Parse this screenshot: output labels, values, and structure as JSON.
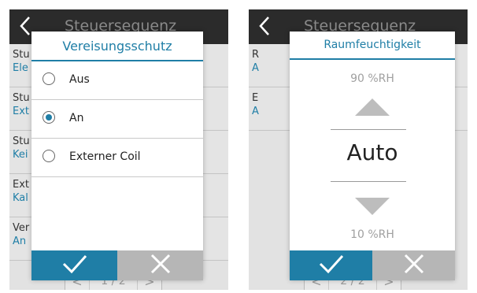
{
  "left_screen": {
    "header_title": "Steuersequenz",
    "background_rows": [
      {
        "label": "Stu",
        "value": "Ele"
      },
      {
        "label": "Stu",
        "value": "Ext"
      },
      {
        "label": "Stu",
        "value": "Kei"
      },
      {
        "label": "Ext",
        "value": "Kal"
      },
      {
        "label": "Ver",
        "value": "An"
      }
    ],
    "pager": {
      "prev": "<",
      "label": "1 / 2",
      "next": ">"
    },
    "dialog": {
      "title": "Vereisungsschutz",
      "options": [
        {
          "label": "Aus",
          "selected": false
        },
        {
          "label": "An",
          "selected": true
        },
        {
          "label": "Externer Coil",
          "selected": false
        }
      ],
      "confirm_icon": "check-icon",
      "cancel_icon": "close-icon"
    }
  },
  "right_screen": {
    "header_title": "Steuersequenz",
    "background_rows": [
      {
        "label": "R",
        "value": "A"
      },
      {
        "label": "E",
        "value": "A"
      }
    ],
    "pager": {
      "prev": "<",
      "label": "2 / 2",
      "next": ">"
    },
    "dialog": {
      "title": "Raumfeuchtigkeit",
      "max_label": "90 %RH",
      "value": "Auto",
      "min_label": "10 %RH",
      "confirm_icon": "check-icon",
      "cancel_icon": "close-icon"
    }
  },
  "colors": {
    "accent": "#1f7ea6",
    "header_bg": "#2b2b2b",
    "cancel_bg": "#b6b6b6",
    "screen_bg": "#e2e2e2"
  }
}
